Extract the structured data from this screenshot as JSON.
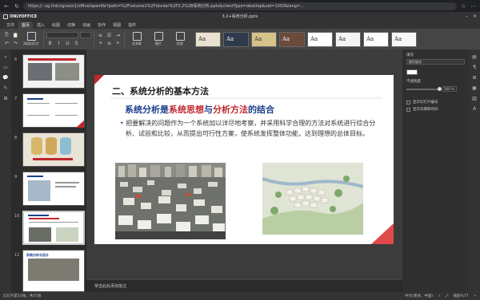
{
  "browser": {
    "url": "https://                .og.link/cgroo/s1/office/openfile?path=%2Fvolume1%2Fdocker%2F3.2%2B系统分析.pptx&clientType=desktop&uid=1003&lang=..."
  },
  "app": {
    "logo": "ONLYOFFICE",
    "title": "3.2+系统分析.pptx"
  },
  "menu": {
    "tabs": [
      "文件",
      "首页",
      "插入",
      "绘图",
      "切换",
      "动画",
      "协作",
      "视图",
      "插件"
    ],
    "active": 1
  },
  "toolbar": {
    "new_slide": "添加幻灯片",
    "text_art": "文本框",
    "image": "图片",
    "shape": "形状",
    "theme_labels": [
      "Aa",
      "Aa",
      "Aa",
      "Aa",
      "Aa",
      "Aa",
      "Aa",
      "Aa"
    ]
  },
  "slide": {
    "heading": "二、系统分析的基本方法",
    "subtitle": {
      "p1": "系统分析",
      "p2": "是",
      "p3": "系统思想",
      "p4": "与",
      "p5": "分析方法",
      "p6": "的结合"
    },
    "body": "把要解决的问题作为一个系统加以详尽地考察，并采用科学合理的方法对系统进行综合分析、试验和比较，从而提出可行性方案，使系统发挥整体功能，达到理想的总体目标。"
  },
  "thumbs": {
    "numbers": [
      "6",
      "7",
      "8",
      "9",
      "10",
      "11"
    ],
    "t11_title": "系统分析与设计"
  },
  "notes": {
    "placeholder": "单击此处添加批注"
  },
  "rpanel": {
    "fill_label": "填充",
    "fill_value": "颜色填充",
    "opacity_label": "不透明度",
    "opacity_value": "100 %",
    "c1": "显示幻灯片编号",
    "c2": "显示日期和时间"
  },
  "status": {
    "left": "幻灯片第10张，共25张",
    "lang": "中文(简体，中国)",
    "zoom": "缩放%77"
  },
  "colors": {
    "red": "#c0272d",
    "blue": "#1a3e8c",
    "accent": "#e04a4a"
  }
}
